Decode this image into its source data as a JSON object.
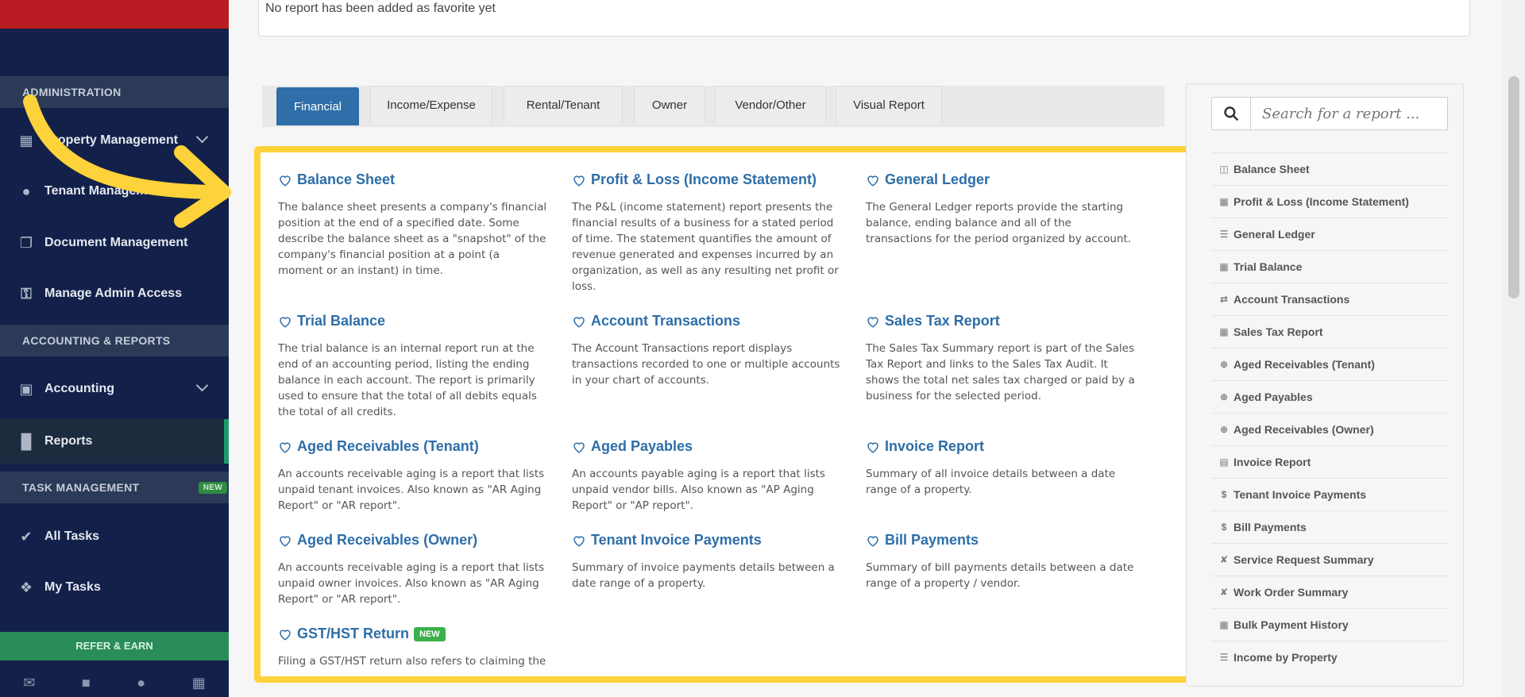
{
  "sidebar": {
    "sections": [
      "ADMINISTRATION",
      "ACCOUNTING & REPORTS",
      "TASK MANAGEMENT"
    ],
    "task_badge": "NEW",
    "items": [
      {
        "label": "Property Management",
        "icon": "building-icon"
      },
      {
        "label": "Tenant Management",
        "icon": "users-icon"
      },
      {
        "label": "Document Management",
        "icon": "documents-icon"
      },
      {
        "label": "Manage Admin Access",
        "icon": "key-icon"
      },
      {
        "label": "Accounting",
        "icon": "money-icon"
      },
      {
        "label": "Reports",
        "icon": "bar-chart-icon"
      },
      {
        "label": "All Tasks",
        "icon": "check-icon"
      },
      {
        "label": "My Tasks",
        "icon": "tag-icon"
      }
    ],
    "refer": "REFER & EARN"
  },
  "favorites": {
    "empty_text": "No report has been added as favorite yet"
  },
  "tabs": [
    "Financial",
    "Income/Expense",
    "Rental/Tenant",
    "Owner",
    "Vendor/Other",
    "Visual Report"
  ],
  "cards": [
    {
      "title": "Balance Sheet",
      "desc": "The balance sheet presents a company's financial position at the end of a specified date. Some describe the balance sheet as a \"snapshot\" of the company's financial position at a point (a moment or an instant) in time."
    },
    {
      "title": "Profit & Loss (Income Statement)",
      "desc": "The P&L (income statement) report presents the financial results of a business for a stated period of time. The statement quantifies the amount of revenue generated and expenses incurred by an organization, as well as any resulting net profit or loss."
    },
    {
      "title": "General Ledger",
      "desc": "The General Ledger reports provide the starting balance, ending balance and all of the transactions for the period organized by account."
    },
    {
      "title": "Trial Balance",
      "desc": "The trial balance is an internal report run at the end of an accounting period, listing the ending balance in each account. The report is primarily used to ensure that the total of all debits equals the total of all credits."
    },
    {
      "title": "Account Transactions",
      "desc": "The Account Transactions report displays transactions recorded to one or multiple accounts in your chart of accounts."
    },
    {
      "title": "Sales Tax Report",
      "desc": "The Sales Tax Summary report is part of the Sales Tax Report and links to the Sales Tax Audit. It shows the total net sales tax charged or paid by a business for the selected period."
    },
    {
      "title": "Aged Receivables (Tenant)",
      "desc": "An accounts receivable aging is a report that lists unpaid tenant invoices. Also known as \"AR Aging Report\" or \"AR report\"."
    },
    {
      "title": "Aged Payables",
      "desc": "An accounts payable aging is a report that lists unpaid vendor bills. Also known as \"AP Aging Report\" or \"AP report\"."
    },
    {
      "title": "Invoice Report",
      "desc": "Summary of all invoice details between a date range of a property."
    },
    {
      "title": "Aged Receivables (Owner)",
      "desc": "An accounts receivable aging is a report that lists unpaid owner invoices. Also known as \"AR Aging Report\" or \"AR report\"."
    },
    {
      "title": "Tenant Invoice Payments",
      "desc": "Summary of invoice payments details between a date range of a property."
    },
    {
      "title": "Bill Payments",
      "desc": "Summary of bill payments details between a date range of a property / vendor."
    },
    {
      "title": "GST/HST Return",
      "desc": "Filing a GST/HST return also refers to claiming the",
      "badge": "NEW"
    }
  ],
  "search": {
    "placeholder": "Search for a report ..."
  },
  "report_list": [
    {
      "label": "Balance Sheet",
      "icon": "columns-icon"
    },
    {
      "label": "Profit & Loss (Income Statement)",
      "icon": "calculator-icon"
    },
    {
      "label": "General Ledger",
      "icon": "list-icon"
    },
    {
      "label": "Trial Balance",
      "icon": "calendar-icon"
    },
    {
      "label": "Account Transactions",
      "icon": "exchange-icon"
    },
    {
      "label": "Sales Tax Report",
      "icon": "calculator-icon"
    },
    {
      "label": "Aged Receivables (Tenant)",
      "icon": "arrow-circle-icon"
    },
    {
      "label": "Aged Payables",
      "icon": "arrow-circle-icon"
    },
    {
      "label": "Aged Receivables (Owner)",
      "icon": "arrow-circle-icon"
    },
    {
      "label": "Invoice Report",
      "icon": "file-icon"
    },
    {
      "label": "Tenant Invoice Payments",
      "icon": "dollar-icon"
    },
    {
      "label": "Bill Payments",
      "icon": "dollar-icon"
    },
    {
      "label": "Service Request Summary",
      "icon": "wrench-icon"
    },
    {
      "label": "Work Order Summary",
      "icon": "wrench-icon"
    },
    {
      "label": "Bulk Payment History",
      "icon": "calculator-icon"
    },
    {
      "label": "Income by Property",
      "icon": "list-icon"
    }
  ],
  "colors": {
    "accent": "#2f6ea8",
    "highlight": "#fdd23a",
    "sidebar": "#13214a",
    "arrow": "#fdd23a"
  }
}
